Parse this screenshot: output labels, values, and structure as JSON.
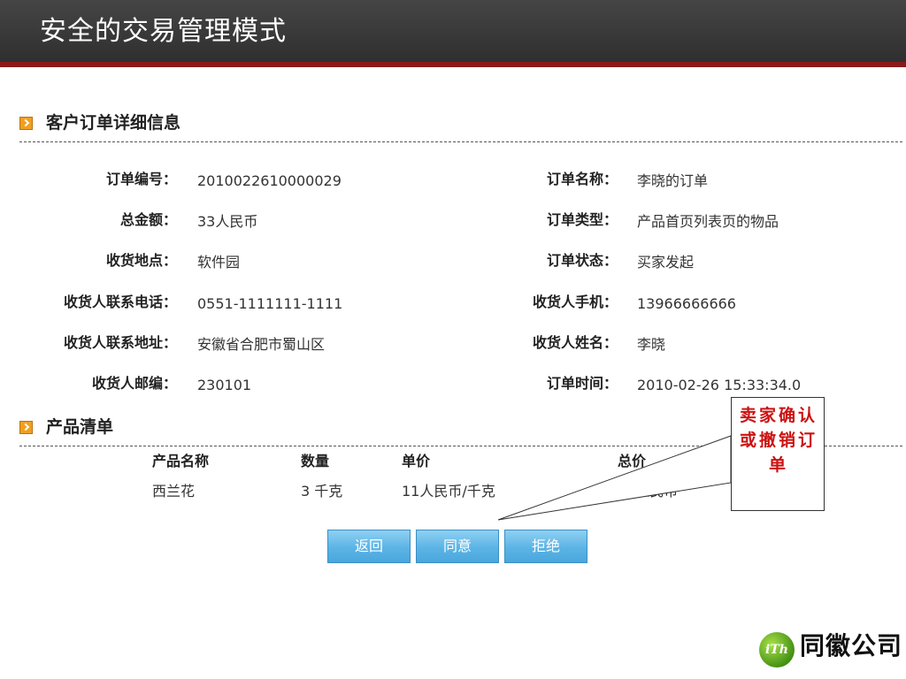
{
  "title": "安全的交易管理模式",
  "colors": {
    "title_bar": "#3a3a3a",
    "title_stripe": "#8a1a1a",
    "section_icon": "#f0a020",
    "button": "#5bb4e6",
    "callout_text": "#cc1111",
    "logo_green": "#5aa82a"
  },
  "order_section": {
    "icon": "section-bullet-icon",
    "title": "客户订单详细信息",
    "left_fields": [
      {
        "label": "订单编号：",
        "value": "2010022610000029"
      },
      {
        "label": "总金额：",
        "value": "33人民币"
      },
      {
        "label": "收货地点：",
        "value": "软件园"
      },
      {
        "label": "收货人联系电话：",
        "value": "0551-1111111-1111"
      },
      {
        "label": "收货人联系地址：",
        "value": "安徽省合肥市蜀山区"
      },
      {
        "label": "收货人邮编：",
        "value": "230101"
      }
    ],
    "right_fields": [
      {
        "label": "订单名称：",
        "value": "李晓的订单"
      },
      {
        "label": "订单类型：",
        "value": "产品首页列表页的物品"
      },
      {
        "label": "订单状态：",
        "value": "买家发起"
      },
      {
        "label": "收货人手机：",
        "value": "13966666666"
      },
      {
        "label": "收货人姓名：",
        "value": "李晓"
      },
      {
        "label": "订单时间：",
        "value": "2010-02-26 15:33:34.0"
      }
    ]
  },
  "product_section": {
    "icon": "section-bullet-icon",
    "title": "产品清单",
    "columns": [
      "产品名称",
      "数量",
      "单价",
      "总价"
    ],
    "rows": [
      [
        "西兰花",
        "3 千克",
        "11人民币/千克",
        "33人民币"
      ]
    ]
  },
  "buttons": {
    "back": "返回",
    "agree": "同意",
    "reject": "拒绝"
  },
  "callout": {
    "text": "卖家确认或撤销订单"
  },
  "logo": {
    "mark": "iTh",
    "name": "同徽公司"
  }
}
